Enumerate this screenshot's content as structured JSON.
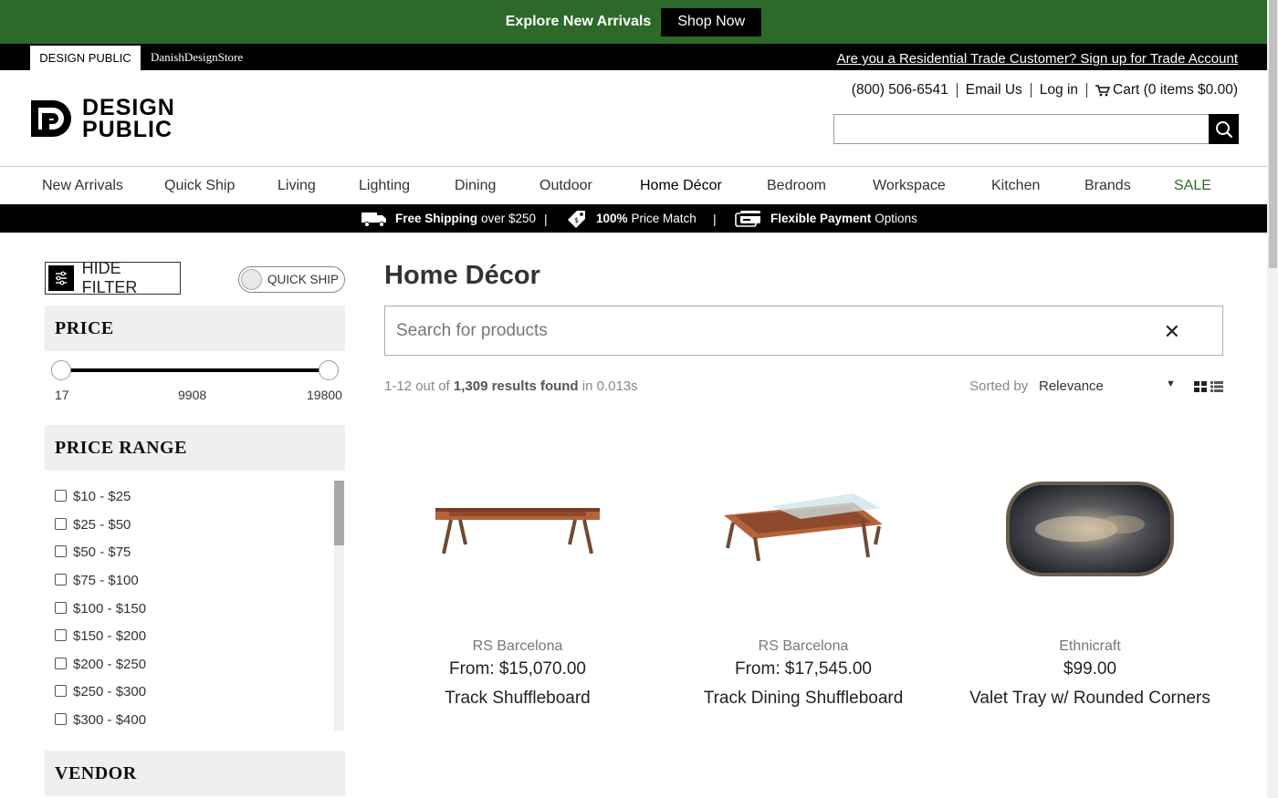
{
  "promo": {
    "text": "Explore New Arrivals",
    "button": "Shop Now"
  },
  "storebar": {
    "active_tab": "DESIGN PUBLIC",
    "other_tab": "DanishDesignStore",
    "trade_link": "Are you a Residential Trade Customer? Sign up for Trade Account"
  },
  "header": {
    "logo_line1": "DESIGN",
    "logo_line2": "PUBLIC",
    "phone": "(800) 506-6541",
    "email": "Email Us",
    "login": "Log in",
    "cart": "Cart (0 items $0.00)",
    "search_placeholder": ""
  },
  "nav": [
    "New Arrivals",
    "Quick Ship",
    "Living",
    "Lighting",
    "Dining",
    "Outdoor",
    "Home Décor",
    "Bedroom",
    "Workspace",
    "Kitchen",
    "Brands",
    "SALE"
  ],
  "benefits": [
    {
      "bold": "Free Shipping",
      "rest": "over $250"
    },
    {
      "bold": "100%",
      "rest": "Price Match"
    },
    {
      "bold": "Flexible Payment",
      "rest": "Options"
    }
  ],
  "sidebar": {
    "hide_filter": "HIDE FILTER",
    "quick_ship": "QUICK SHIP",
    "price_heading": "PRICE",
    "price_min": "17",
    "price_mid": "9908",
    "price_max": "19800",
    "range_heading": "PRICE RANGE",
    "ranges": [
      "$10 - $25",
      "$25 - $50",
      "$50 - $75",
      "$75 - $100",
      "$100 - $150",
      "$150 - $200",
      "$200 - $250",
      "$250 - $300",
      "$300 - $400"
    ],
    "vendor_heading": "VENDOR"
  },
  "main": {
    "title": "Home Décor",
    "search_placeholder": "Search for products",
    "results_pre": "1-12 out of",
    "results_count": "1,309 results found",
    "results_post": "in 0.013s",
    "sort_label": "Sorted by",
    "sort_value": "Relevance"
  },
  "products": [
    {
      "brand": "RS Barcelona",
      "price": "From: $15,070.00",
      "name": "Track Shuffleboard"
    },
    {
      "brand": "RS Barcelona",
      "price": "From: $17,545.00",
      "name": "Track Dining Shuffleboard"
    },
    {
      "brand": "Ethnicraft",
      "price": "$99.00",
      "name": "Valet Tray w/ Rounded Corners"
    }
  ],
  "colors": {
    "brand_green": "#2d6a29",
    "black": "#000000",
    "filter_bg": "#efefef"
  }
}
